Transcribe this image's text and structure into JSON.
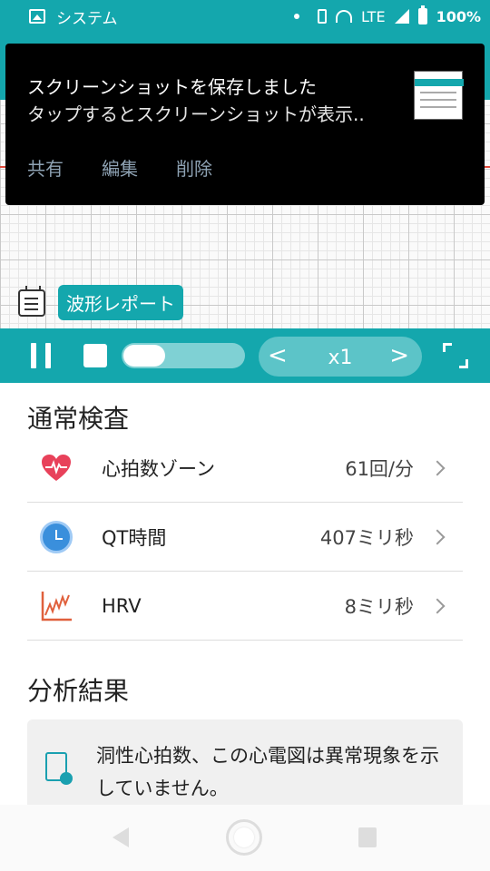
{
  "status_bar": {
    "app_label": "システム",
    "network": "LTE",
    "battery": "100%"
  },
  "notification": {
    "title": "スクリーンショットを保存しました",
    "subtitle": "タップするとスクリーンショットが表示..",
    "actions": [
      "共有",
      "編集",
      "削除"
    ]
  },
  "ecg": {
    "report_label": "波形レポート"
  },
  "player": {
    "progress": 0.35,
    "speed_prev": "<",
    "speed": "x1",
    "speed_next": ">"
  },
  "normal_check": {
    "title": "通常検査",
    "items": [
      {
        "icon": "heart-icon",
        "label": "心拍数ゾーン",
        "value": "61回/分"
      },
      {
        "icon": "clock-icon",
        "label": "QT時間",
        "value": "407ミリ秒"
      },
      {
        "icon": "hrv-chart-icon",
        "label": "HRV",
        "value": "8ミリ秒"
      }
    ]
  },
  "analysis": {
    "title": "分析結果",
    "result": "洞性心拍数、この心電図は異常現象を示していません。"
  },
  "colors": {
    "accent": "#14a7ad",
    "heart": "#e8415a",
    "clock": "#3a8fdc",
    "hrv": "#e0603c"
  }
}
